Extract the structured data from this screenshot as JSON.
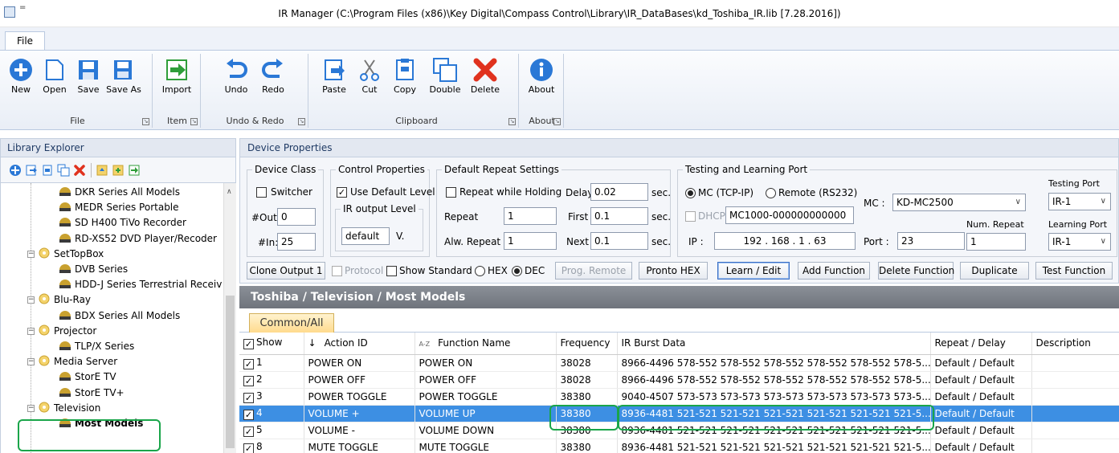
{
  "window": {
    "title": "IR Manager (C:\\Program Files (x86)\\Key Digital\\Compass Control\\Library\\IR_DataBases\\kd_Toshiba_IR.lib [7.28.2016])",
    "quick_access": "="
  },
  "menu": {
    "file_tab": "File"
  },
  "ribbon": {
    "groups": [
      {
        "label": "File",
        "buttons": [
          {
            "label": "New",
            "icon": "plus-circle-icon"
          },
          {
            "label": "Open",
            "icon": "open-folder-icon"
          },
          {
            "label": "Save",
            "icon": "floppy-disk-icon"
          },
          {
            "label": "Save As",
            "icon": "save-as-icon"
          }
        ]
      },
      {
        "label": "Item",
        "buttons": [
          {
            "label": "Import",
            "icon": "import-arrow-icon"
          }
        ]
      },
      {
        "label": "Undo & Redo",
        "buttons": [
          {
            "label": "Undo",
            "icon": "undo-arrow-icon"
          },
          {
            "label": "Redo",
            "icon": "redo-arrow-icon"
          }
        ]
      },
      {
        "label": "Clipboard",
        "buttons": [
          {
            "label": "Paste",
            "icon": "paste-icon"
          },
          {
            "label": "Cut",
            "icon": "scissors-icon"
          },
          {
            "label": "Copy",
            "icon": "copy-icon"
          },
          {
            "label": "Double",
            "icon": "double-window-icon"
          },
          {
            "label": "Delete",
            "icon": "red-x-icon"
          }
        ]
      },
      {
        "label": "About",
        "buttons": [
          {
            "label": "About",
            "icon": "info-icon"
          }
        ]
      }
    ],
    "colors": {
      "blue": "#2a78d6",
      "green": "#2f9e3a",
      "red": "#e0321e"
    }
  },
  "library": {
    "title": "Library Explorer",
    "tree": [
      {
        "label": "DKR Series All Models",
        "level": 2
      },
      {
        "label": "MEDR Series Portable",
        "level": 2
      },
      {
        "label": "SD H400 TiVo Recorder",
        "level": 2
      },
      {
        "label": "RD-XS52 DVD Player/Recoder",
        "level": 2
      },
      {
        "label": "SetTopBox",
        "level": 1
      },
      {
        "label": "DVB Series",
        "level": 2
      },
      {
        "label": "HDD-J Series Terrestrial Receiv",
        "level": 2
      },
      {
        "label": "Blu-Ray",
        "level": 1
      },
      {
        "label": "BDX Series All Models",
        "level": 2
      },
      {
        "label": "Projector",
        "level": 1
      },
      {
        "label": "TLP/X Series",
        "level": 2
      },
      {
        "label": "Media Server",
        "level": 1
      },
      {
        "label": "StorE TV",
        "level": 2
      },
      {
        "label": "StorE TV+",
        "level": 2
      },
      {
        "label": "Television",
        "level": 1
      },
      {
        "label": "Most Models",
        "level": 2,
        "bold": true
      }
    ]
  },
  "device": {
    "title": "Device Properties",
    "device_class": {
      "legend": "Device Class",
      "switcher": "Switcher",
      "out_label": "#Out:",
      "out_value": "0",
      "in_label": "#In:",
      "in_value": "25"
    },
    "control": {
      "legend": "Control Properties",
      "use_default": "Use Default Level",
      "ir_level_legend": "IR output Level",
      "ir_level_value": "default",
      "v_unit": "V."
    },
    "repeat": {
      "legend": "Default Repeat Settings",
      "repeat_while_holding": "Repeat while Holding",
      "delay_label": "Delay",
      "delay_value": "0.02",
      "sec": "sec.",
      "repeat_label": "Repeat",
      "repeat_value": "1",
      "first_label": "First",
      "first_value": "0.1",
      "alw_label": "Alw. Repeat",
      "alw_value": "1",
      "next_label": "Next",
      "next_value": "0.1"
    },
    "testing": {
      "legend": "Testing and Learning Port",
      "mc_option": "MC (TCP-IP)",
      "remote_option": "Remote (RS232)",
      "mc_label": "MC :",
      "mc_value": "KD-MC2500",
      "dhcp": "DHCP",
      "dhcp_value": "MC1000-000000000000",
      "ip_label": "IP :",
      "ip_value": "192 . 168 . 1 . 63",
      "port_label": "Port :",
      "port_value": "23",
      "num_repeat_label": "Num. Repeat",
      "num_repeat_value": "1",
      "testing_port_label": "Testing Port",
      "testing_port_value": "IR-1",
      "learning_port_label": "Learning Port",
      "learning_port_value": "IR-1"
    },
    "buttons": {
      "clone_output": "Clone Output 1",
      "protocol": "Protocol",
      "show_standard": "Show Standard",
      "hex": "HEX",
      "dec": "DEC",
      "prog_remote": "Prog. Remote",
      "pronto_hex": "Pronto HEX",
      "learn_edit": "Learn / Edit",
      "add_function": "Add Function",
      "delete_function": "Delete Function",
      "duplicate": "Duplicate",
      "test_function": "Test Function"
    }
  },
  "path": "Toshiba / Television / Most Models",
  "tab": "Common/All",
  "table": {
    "headers": {
      "show": "Show",
      "sort_arrow": "↓",
      "action_id": "Action ID",
      "az": "A-Z",
      "function_name": "Function Name",
      "frequency": "Frequency",
      "ir_burst": "IR Burst Data",
      "repeat_delay": "Repeat / Delay",
      "description": "Description"
    },
    "rows": [
      {
        "num": "1",
        "action": "POWER ON",
        "function": "POWER ON",
        "freq": "38028",
        "burst": "8966-4496 578-552 578-552 578-552 578-552 578-552 578-5...",
        "repeat": "Default / Default",
        "desc": ""
      },
      {
        "num": "2",
        "action": "POWER OFF",
        "function": "POWER OFF",
        "freq": "38028",
        "burst": "8966-4496 578-552 578-552 578-552 578-552 578-552 578-5...",
        "repeat": "Default / Default",
        "desc": ""
      },
      {
        "num": "3",
        "action": "POWER TOGGLE",
        "function": "POWER TOGGLE",
        "freq": "38380",
        "burst": "9040-4507 573-573 573-573 573-573 573-573 573-573 573-5...",
        "repeat": "Default / Default",
        "desc": ""
      },
      {
        "num": "4",
        "action": "VOLUME +",
        "function": "VOLUME UP",
        "freq": "38380",
        "burst": "8936-4481 521-521 521-521 521-521 521-521 521-521 521-5...",
        "repeat": "Default / Default",
        "desc": "",
        "selected": true
      },
      {
        "num": "5",
        "action": "VOLUME -",
        "function": "VOLUME DOWN",
        "freq": "38380",
        "burst": "8936-4481 521-521 521-521 521-521 521-521 521-521 521-5...",
        "repeat": "Default / Default",
        "desc": ""
      },
      {
        "num": "8",
        "action": "MUTE TOGGLE",
        "function": "MUTE TOGGLE",
        "freq": "38380",
        "burst": "8936-4481 521-521 521-521 521-521 521-521 521-521 521-5...",
        "repeat": "Default / Default",
        "desc": ""
      }
    ]
  },
  "highlight_color": "#1aa54a"
}
